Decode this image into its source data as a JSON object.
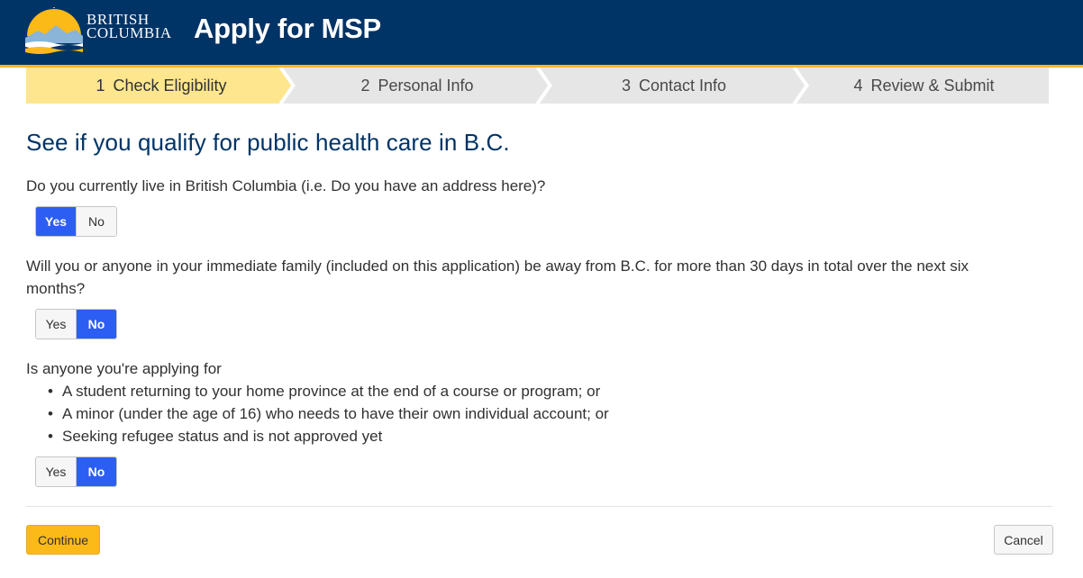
{
  "header": {
    "logo_line1": "BRITISH",
    "logo_line2": "COLUMBIA",
    "title": "Apply for MSP",
    "bg_color": "#003366",
    "accent_color": "#fcba19"
  },
  "steps": [
    {
      "number": "1",
      "label": "Check Eligibility",
      "active": true
    },
    {
      "number": "2",
      "label": "Personal Info",
      "active": false
    },
    {
      "number": "3",
      "label": "Contact Info",
      "active": false
    },
    {
      "number": "4",
      "label": "Review & Submit",
      "active": false
    }
  ],
  "page": {
    "heading": "See if you qualify for public health care in B.C."
  },
  "questions": [
    {
      "text": "Do you currently live in British Columbia (i.e. Do you have an address here)?",
      "yes": "Yes",
      "no": "No",
      "selected": "yes"
    },
    {
      "text": "Will you or anyone in your immediate family (included on this application) be away from B.C. for more than 30 days in total over the next six months?",
      "yes": "Yes",
      "no": "No",
      "selected": "no"
    },
    {
      "text": "Is anyone you're applying for",
      "bullets": [
        "A student returning to your home province at the end of a course or program; or",
        "A minor (under the age of 16) who needs to have their own individual account; or",
        "Seeking refugee status and is not approved yet"
      ],
      "yes": "Yes",
      "no": "No",
      "selected": "no"
    }
  ],
  "actions": {
    "continue_label": "Continue",
    "cancel_label": "Cancel"
  },
  "colors": {
    "active_step": "#fde68e",
    "inactive_step": "#e6e6e6",
    "selected_toggle": "#2d5ef3"
  }
}
